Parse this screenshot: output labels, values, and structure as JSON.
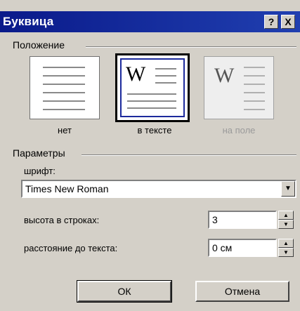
{
  "window": {
    "title": "Буквица",
    "help_button": "?",
    "close_button": "X"
  },
  "position_group": {
    "label": "Положение",
    "options": [
      {
        "id": "none",
        "label": "нет",
        "selected": false,
        "enabled": true
      },
      {
        "id": "in_text",
        "label": "в тексте",
        "selected": true,
        "enabled": true
      },
      {
        "id": "in_margin",
        "label": "на поле",
        "selected": false,
        "enabled": false
      }
    ],
    "preview_letter": "W"
  },
  "params_group": {
    "label": "Параметры",
    "font_label": "шрифт:",
    "font_value": "Times New Roman",
    "lines_label": "высота в строках:",
    "lines_value": "3",
    "distance_label": "расстояние до текста:",
    "distance_value": "0 см"
  },
  "buttons": {
    "ok": "ОК",
    "cancel": "Отмена"
  },
  "colors": {
    "titlebar": "#0a1a8a",
    "dialog_bg": "#d4d0c8",
    "selection_border": "#1c2a9c"
  }
}
